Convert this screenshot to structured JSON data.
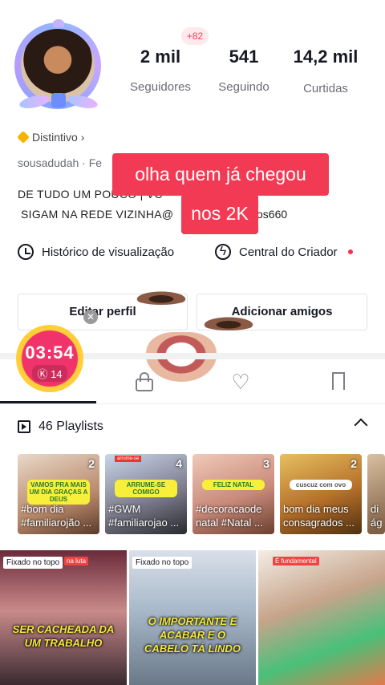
{
  "profile": {
    "stats": [
      {
        "value": "2 mil",
        "label": "Seguidores"
      },
      {
        "value": "541",
        "label": "Seguindo"
      },
      {
        "value": "14,2 mil",
        "label": "Curtidas"
      }
    ],
    "new_followers_badge": "+82",
    "distintivo": "Distintivo",
    "username": "sousadudah · Fe",
    "bio_line1": "DE TUDO UM POUCO | VC",
    "bio_line2": "SIGAM NA REDE VIZINHA@",
    "bio_line2_end": "os660"
  },
  "captions": {
    "line1": "olha quem já chegou",
    "line2": "nos 2K"
  },
  "quick_links": {
    "history": "Histórico de visualização",
    "creator": "Central do Criador"
  },
  "buttons": {
    "edit": "Editar perfil",
    "add_friends": "Adicionar amigos"
  },
  "timer": {
    "time": "03:54",
    "coins": "14"
  },
  "playlists": {
    "header": "46 Playlists",
    "items": [
      {
        "count": "2",
        "label": "#bom dia #familiarojão ...",
        "sticker": "VAMOS PRA MAIS UM DIA GRAÇAS A DEUS"
      },
      {
        "count": "4",
        "label": "#GWM #familiarojao ...",
        "sticker": "ARRUME-SE COMIGO"
      },
      {
        "count": "3",
        "label": "#decoracaode natal #Natal ...",
        "sticker": "FELIZ NATAL"
      },
      {
        "count": "2",
        "label": "bom dia meus consagrados ...",
        "sticker": "cuscuz com ovo"
      },
      {
        "count": "",
        "label": "di ág",
        "sticker": ""
      }
    ]
  },
  "videos": [
    {
      "pinned": "Fixado no topo",
      "text": "SER CACHEADA DA UM TRABALHO"
    },
    {
      "pinned": "Fixado no topo",
      "text": "O IMPORTANTE E ACABAR E O CABELO TÁ LINDO"
    },
    {
      "pinned": "",
      "text": ""
    }
  ],
  "colors": {
    "accent": "#fe2c55",
    "caption_bg": "#f23a55",
    "timer_ring": "#ffcf3a"
  }
}
